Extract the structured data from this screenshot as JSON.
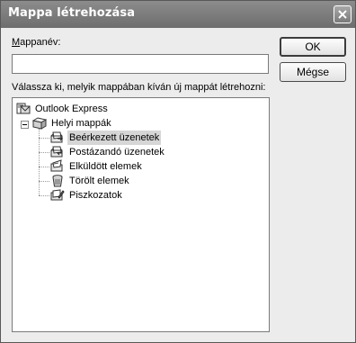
{
  "dialog": {
    "title": "Mappa létrehozása"
  },
  "name_field": {
    "label_accesskey": "M",
    "label_rest": "appanév:",
    "value": ""
  },
  "tree_prompt": "Válassza ki, melyik mappában kíván új mappát létrehozni:",
  "tree": {
    "root": {
      "label": "Outlook Express",
      "icon": "outlook-express-icon"
    },
    "local": {
      "label": "Helyi mappák",
      "icon": "local-folders-icon",
      "expanded": true
    },
    "folders": [
      {
        "label": "Beérkezett üzenetek",
        "icon": "inbox-folder-icon",
        "selected": true
      },
      {
        "label": "Postázandó üzenetek",
        "icon": "outbox-folder-icon",
        "selected": false
      },
      {
        "label": "Elküldött elemek",
        "icon": "sent-items-folder-icon",
        "selected": false
      },
      {
        "label": "Törölt elemek",
        "icon": "deleted-items-folder-icon",
        "selected": false
      },
      {
        "label": "Piszkozatok",
        "icon": "drafts-folder-icon",
        "selected": false
      }
    ]
  },
  "buttons": {
    "ok": "OK",
    "cancel": "Mégse"
  }
}
